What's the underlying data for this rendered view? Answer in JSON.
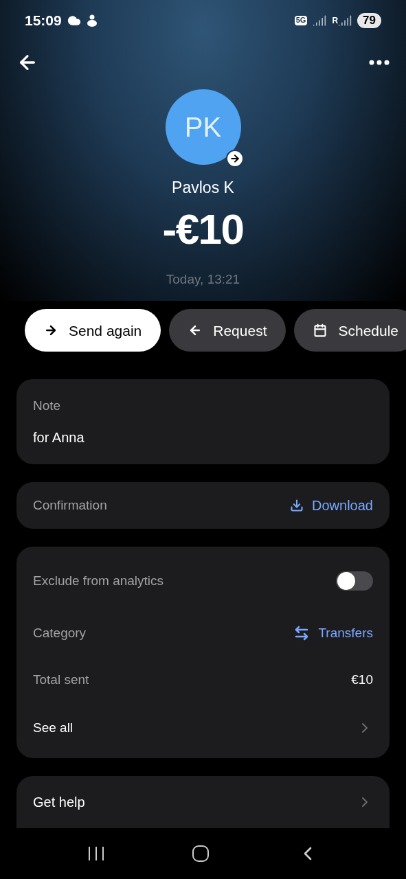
{
  "status_bar": {
    "time": "15:09",
    "network": "5G",
    "roaming": "R",
    "battery": "79"
  },
  "header": {
    "initials": "PK",
    "name": "Pavlos K",
    "amount": "-€10",
    "date": "Today, 13:21"
  },
  "actions": [
    {
      "kind": "send",
      "label": "Send again",
      "primary": true
    },
    {
      "kind": "request",
      "label": "Request",
      "primary": false
    },
    {
      "kind": "schedule",
      "label": "Schedule",
      "primary": false
    }
  ],
  "note": {
    "label": "Note",
    "value": "for Anna"
  },
  "confirmation": {
    "label": "Confirmation",
    "action": "Download"
  },
  "details": [
    {
      "kind": "toggle",
      "label": "Exclude from analytics",
      "on": false
    },
    {
      "kind": "link",
      "label": "Category",
      "value": "Transfers"
    },
    {
      "kind": "value",
      "label": "Total sent",
      "value": "€10"
    },
    {
      "kind": "nav",
      "label": "See all"
    }
  ],
  "help": {
    "label": "Get help"
  }
}
